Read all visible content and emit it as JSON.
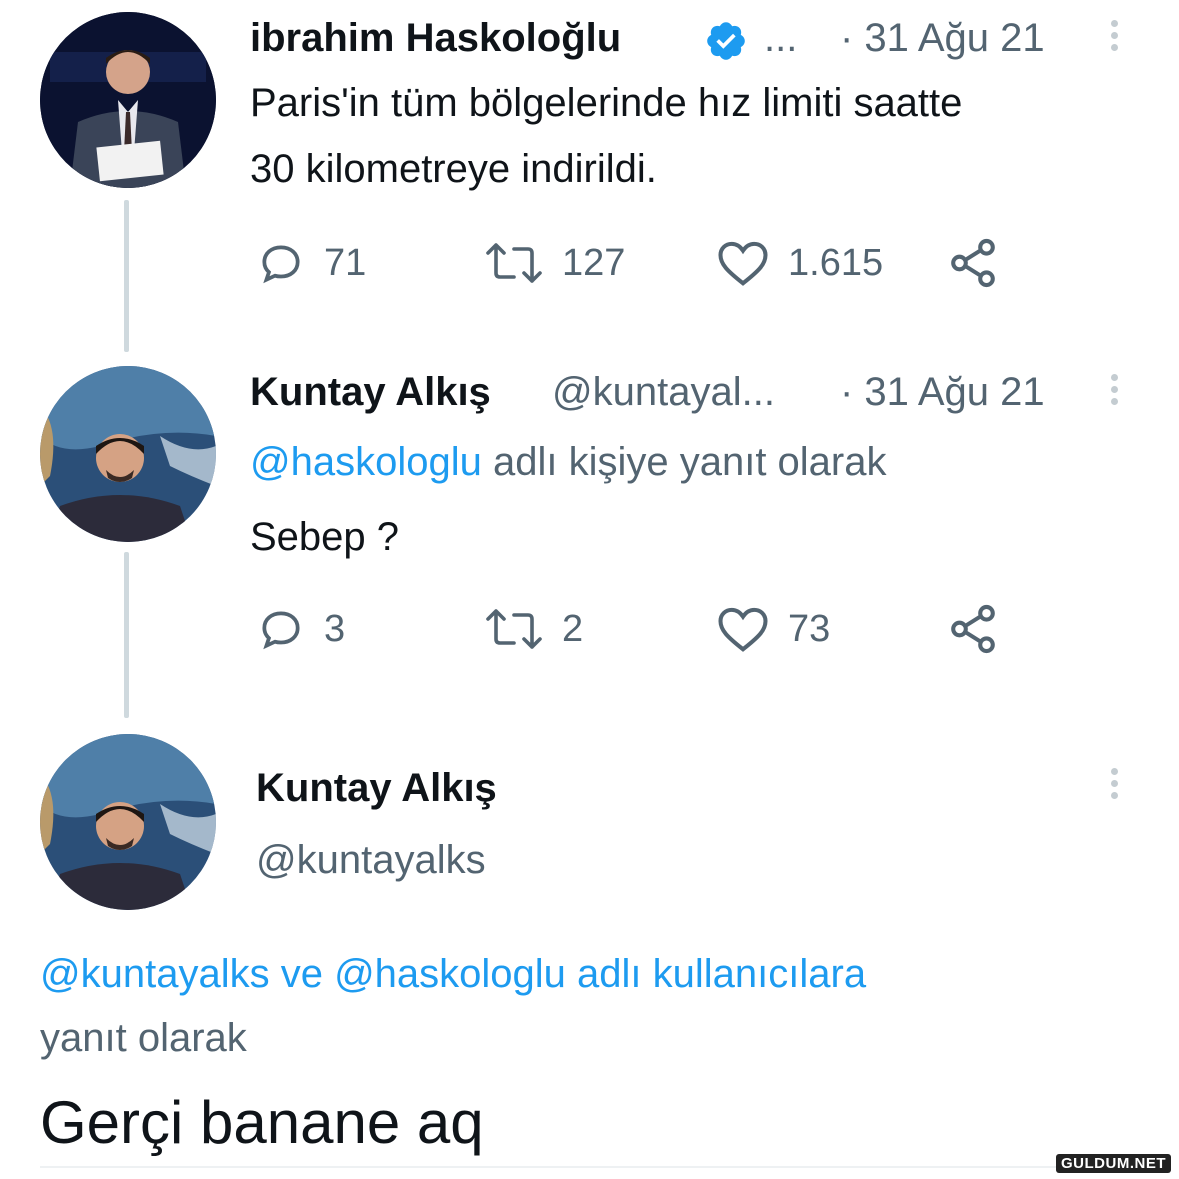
{
  "tweet1": {
    "name": "ibrahim Haskoloğlu",
    "handle": "...",
    "date": "· 31 Ağu 21",
    "text_line1": "Paris'in tüm bölgelerinde hız limiti saatte",
    "text_line2": "30 kilometreye indirildi.",
    "replies": "71",
    "retweets": "127",
    "likes": "1.615"
  },
  "tweet2": {
    "name": "Kuntay Alkış",
    "handle": "@kuntayal...",
    "date": "· 31 Ağu 21",
    "reply_mention": "@haskologlu",
    "reply_suffix": " adlı kişiye yanıt olarak",
    "text": "Sebep ?",
    "replies": "3",
    "retweets": "2",
    "likes": "73"
  },
  "tweet3": {
    "name": "Kuntay Alkış",
    "handle": "@kuntayalks",
    "reply_line1": "@kuntayalks ve @haskologlu adlı kullanıcılara",
    "reply_line2": "yanıt olarak",
    "text": "Gerçi banane aq"
  },
  "watermark": "GULDUM.NET",
  "icons": [
    "verified-badge-icon",
    "more-options-icon",
    "reply-icon",
    "retweet-icon",
    "like-icon",
    "share-icon"
  ],
  "colors": {
    "accent": "#1d9bf0",
    "muted": "#536471",
    "text": "#0f1419",
    "thread_line": "#cfd9de"
  }
}
